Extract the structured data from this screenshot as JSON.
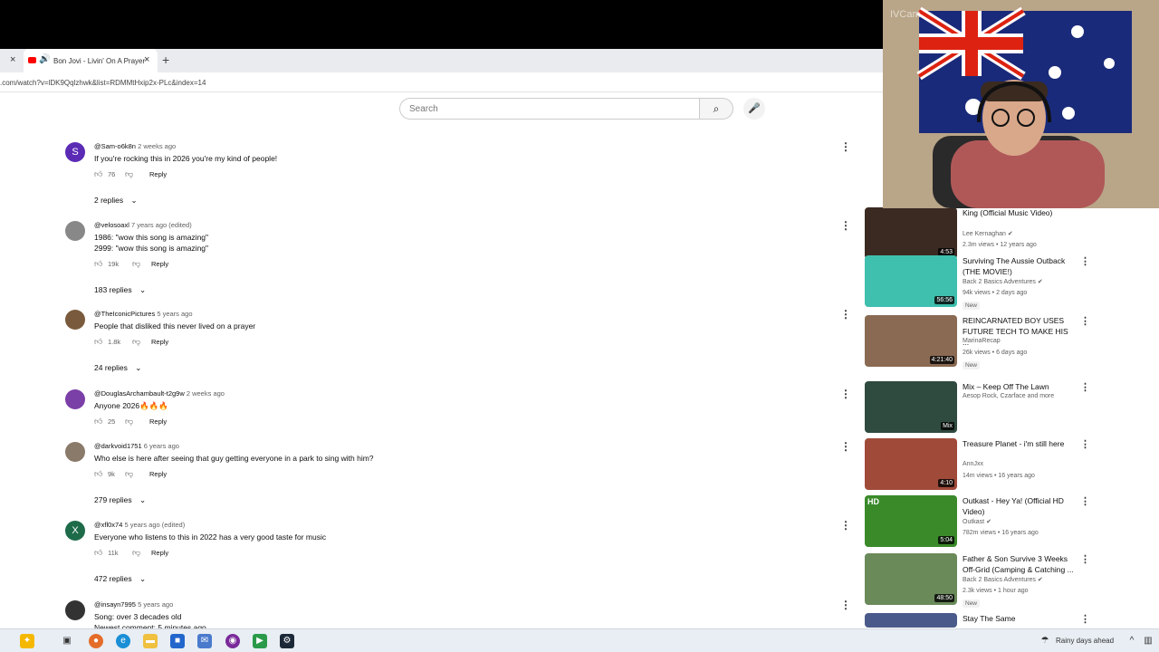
{
  "browser": {
    "active_tab_title": "Bon Jovi - Livin' On A Prayer",
    "url": ".com/watch?v=lDK9Qqlzhwk&list=RDMMtHxip2x-PLc&index=14",
    "new_tab": "+",
    "close": "×"
  },
  "search": {
    "placeholder": "Search"
  },
  "comments": [
    {
      "handle": "@Sam-o6k8n",
      "time": "2 weeks ago",
      "lines": [
        "If you're rocking this in 2026 you're my kind of people!"
      ],
      "likes": "76",
      "reply": "Reply",
      "replies": "2 replies",
      "avatar_letter": "S",
      "avatar_color": "#5b2bb5"
    },
    {
      "handle": "@velosoaxl",
      "time": "7 years ago (edited)",
      "lines": [
        "1986: \"wow this song is amazing\"",
        "2999: \"wow this song is amazing\""
      ],
      "likes": "19k",
      "reply": "Reply",
      "replies": "183 replies",
      "avatar_letter": "",
      "avatar_color": "#888888"
    },
    {
      "handle": "@TheIconicPictures",
      "time": "5 years ago",
      "lines": [
        "People that disliked this never lived on a prayer"
      ],
      "likes": "1.8k",
      "reply": "Reply",
      "replies": "24 replies",
      "avatar_letter": "",
      "avatar_color": "#7a5a3c"
    },
    {
      "handle": "@DouglasArchambault-t2g9w",
      "time": "2 weeks ago",
      "lines": [
        "Anyone 2026🔥🔥🔥"
      ],
      "likes": "25",
      "reply": "Reply",
      "replies": "",
      "avatar_letter": "",
      "avatar_color": "#7b3fa8"
    },
    {
      "handle": "@darkvoid1751",
      "time": "6 years ago",
      "lines": [
        "Who else is here after seeing that guy getting everyone in a park to sing with him?"
      ],
      "likes": "9k",
      "reply": "Reply",
      "replies": "279 replies",
      "avatar_letter": "",
      "avatar_color": "#8a7a6a"
    },
    {
      "handle": "@xfl0x74",
      "time": "5 years ago (edited)",
      "lines": [
        "Everyone who listens to this in 2022 has a very good taste for music"
      ],
      "likes": "11k",
      "reply": "Reply",
      "replies": "472 replies",
      "avatar_letter": "X",
      "avatar_color": "#1e6b4a"
    },
    {
      "handle": "@insayn7995",
      "time": "5 years ago",
      "lines": [
        "Song: over 3 decades old",
        "Newest comment: 5 minutes ago"
      ],
      "likes": "",
      "reply": "",
      "replies": "",
      "avatar_letter": "",
      "avatar_color": "#333333"
    }
  ],
  "sidebar_videos": [
    {
      "title": "King (Official Music Video)",
      "channel": "Lee Kernaghan",
      "stats": "2.3m views • 12 years ago",
      "duration": "4:53",
      "is_new": false,
      "verified": true,
      "thumb_color": "#3a2a22"
    },
    {
      "title": "Surviving The Aussie Outback (THE MOVIE!)",
      "channel": "Back 2 Basics Adventures",
      "stats": "94k views • 2 days ago",
      "duration": "56:56",
      "is_new": true,
      "verified": true,
      "thumb_color": "#3fbfae"
    },
    {
      "title": "REINCARNATED BOY USES FUTURE TECH TO MAKE HIS ...",
      "channel": "MarinaRecap",
      "stats": "26k views • 6 days ago",
      "duration": "4:21:40",
      "is_new": true,
      "verified": false,
      "thumb_color": "#8a6a52"
    },
    {
      "title": "Mix – Keep Off The Lawn",
      "channel": "Aesop Rock, Czarface and more",
      "stats": "",
      "duration": "Mix",
      "is_new": false,
      "verified": false,
      "thumb_color": "#2f4a3e"
    },
    {
      "title": "Treasure Planet - i'm still here",
      "channel": "AnnJxx",
      "stats": "14m views • 16 years ago",
      "duration": "4:10",
      "is_new": false,
      "verified": false,
      "thumb_color": "#a04a3a"
    },
    {
      "title": "Outkast - Hey Ya! (Official HD Video)",
      "channel": "Outkast",
      "stats": "782m views • 16 years ago",
      "duration": "5:04",
      "is_new": false,
      "verified": true,
      "thumb_color": "#3a8a2a",
      "badge": "HD"
    },
    {
      "title": "Father & Son Survive 3 Weeks Off-Grid (Camping & Catching ...",
      "channel": "Back 2 Basics Adventures",
      "stats": "2.3k views • 1 hour ago",
      "duration": "48:50",
      "is_new": true,
      "verified": true,
      "thumb_color": "#6a8a5a"
    },
    {
      "title": "Stay The Same",
      "channel": "",
      "stats": "",
      "duration": "",
      "is_new": false,
      "verified": false,
      "thumb_color": "#4a5a8a"
    }
  ],
  "labels": {
    "new": "New",
    "reply": "Reply"
  },
  "webcam": {
    "overlay_text": "IVCam"
  },
  "taskbar": {
    "weather": "Rainy days ahead"
  }
}
